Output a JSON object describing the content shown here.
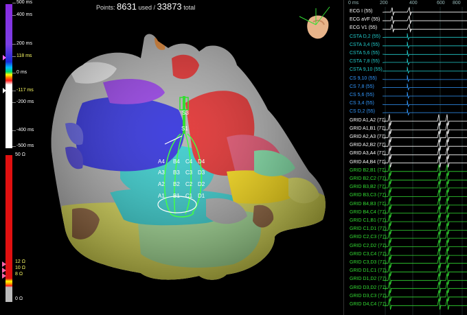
{
  "header": {
    "points_label": "Points:",
    "points_used": "8631",
    "used_label": "used /",
    "points_total": "33873",
    "total_label": "total"
  },
  "lat_scale": {
    "labels": [
      {
        "text": "500 ms",
        "color": "#ffffff"
      },
      {
        "text": "400 ms",
        "color": "#ffffff"
      },
      {
        "text": "200 ms",
        "color": "#ffffff"
      },
      {
        "text": "118 ms",
        "color": "#ffff66"
      },
      {
        "text": "0 ms",
        "color": "#ffffff"
      },
      {
        "text": "-117 ms",
        "color": "#ffff66"
      },
      {
        "text": "-200 ms",
        "color": "#ffffff"
      },
      {
        "text": "-400 ms",
        "color": "#ffffff"
      },
      {
        "text": "-500 ms",
        "color": "#ffffff"
      }
    ]
  },
  "imp_scale": {
    "labels": [
      {
        "text": "50 Ω",
        "color": "#ffffff"
      },
      {
        "text": "12 Ω",
        "color": "#ffff66"
      },
      {
        "text": "10 Ω",
        "color": "#ffff66"
      },
      {
        "text": "8 Ω",
        "color": "#ffff66"
      },
      {
        "text": "0 Ω",
        "color": "#ffffff"
      }
    ]
  },
  "catheter": {
    "shaft_labels": [
      "S3",
      "S1"
    ],
    "grid_labels": [
      "A4",
      "B4",
      "C4",
      "D4",
      "A3",
      "B3",
      "C3",
      "D3",
      "A2",
      "B2",
      "C2",
      "D2",
      "A1",
      "B1",
      "C1",
      "D1"
    ]
  },
  "time_axis": [
    "0 ms",
    "200",
    "400",
    "600",
    "800"
  ],
  "channels": [
    {
      "label": "ECG I (55)",
      "color": "#ffffff"
    },
    {
      "label": "ECG aVF (55)",
      "color": "#ffffff"
    },
    {
      "label": "ECG V1 (55)",
      "color": "#ffffff"
    },
    {
      "label": "CSTA D,2 (55)",
      "color": "#22cccc"
    },
    {
      "label": "CSTA 3,4 (55)",
      "color": "#22cccc"
    },
    {
      "label": "CSTA 5,6 (55)",
      "color": "#22cccc"
    },
    {
      "label": "CSTA 7,8 (55)",
      "color": "#22cccc"
    },
    {
      "label": "CSTA 9,10 (55)",
      "color": "#22cccc"
    },
    {
      "label": "CS 9,10 (55)",
      "color": "#3399ff"
    },
    {
      "label": "CS 7,8 (55)",
      "color": "#3399ff"
    },
    {
      "label": "CS 5,6 (55)",
      "color": "#3399ff"
    },
    {
      "label": "CS 3,4 (55)",
      "color": "#3399ff"
    },
    {
      "label": "CS D,2 (55)",
      "color": "#3399ff"
    },
    {
      "label": "GRID A1,A2 (77)",
      "color": "#ffffff"
    },
    {
      "label": "GRID A1,B1 (77)",
      "color": "#ffffff"
    },
    {
      "label": "GRID A2,A3 (77)",
      "color": "#ffffff"
    },
    {
      "label": "GRID A2,B2 (77)",
      "color": "#ffffff"
    },
    {
      "label": "GRID A3,A4 (77)",
      "color": "#ffffff"
    },
    {
      "label": "GRID A4,B4 (77)",
      "color": "#ffffff"
    },
    {
      "label": "GRID B2,B1 (77)",
      "color": "#33dd33"
    },
    {
      "label": "GRID B2,C2 (77)",
      "color": "#33dd33"
    },
    {
      "label": "GRID B3,B2 (77)",
      "color": "#33dd33"
    },
    {
      "label": "GRID B3,C3 (77)",
      "color": "#33dd33"
    },
    {
      "label": "GRID B4,B3 (77)",
      "color": "#33dd33"
    },
    {
      "label": "GRID B4,C4 (77)",
      "color": "#33dd33"
    },
    {
      "label": "GRID C1,B1 (77)",
      "color": "#33dd33"
    },
    {
      "label": "GRID C1,D1 (77)",
      "color": "#33dd33"
    },
    {
      "label": "GRID C2,C3 (77)",
      "color": "#33dd33"
    },
    {
      "label": "GRID C2,D2 (77)",
      "color": "#33dd33"
    },
    {
      "label": "GRID C3,C4 (77)",
      "color": "#33dd33"
    },
    {
      "label": "GRID C3,D3 (77)",
      "color": "#33dd33"
    },
    {
      "label": "GRID D1,C1 (77)",
      "color": "#33dd33"
    },
    {
      "label": "GRID D1,D2 (77)",
      "color": "#33dd33"
    },
    {
      "label": "GRID D3,D2 (77)",
      "color": "#33dd33"
    },
    {
      "label": "GRID D3,C3 (77)",
      "color": "#33dd33"
    },
    {
      "label": "GRID D4,C4 (77)",
      "color": "#33dd33"
    }
  ]
}
